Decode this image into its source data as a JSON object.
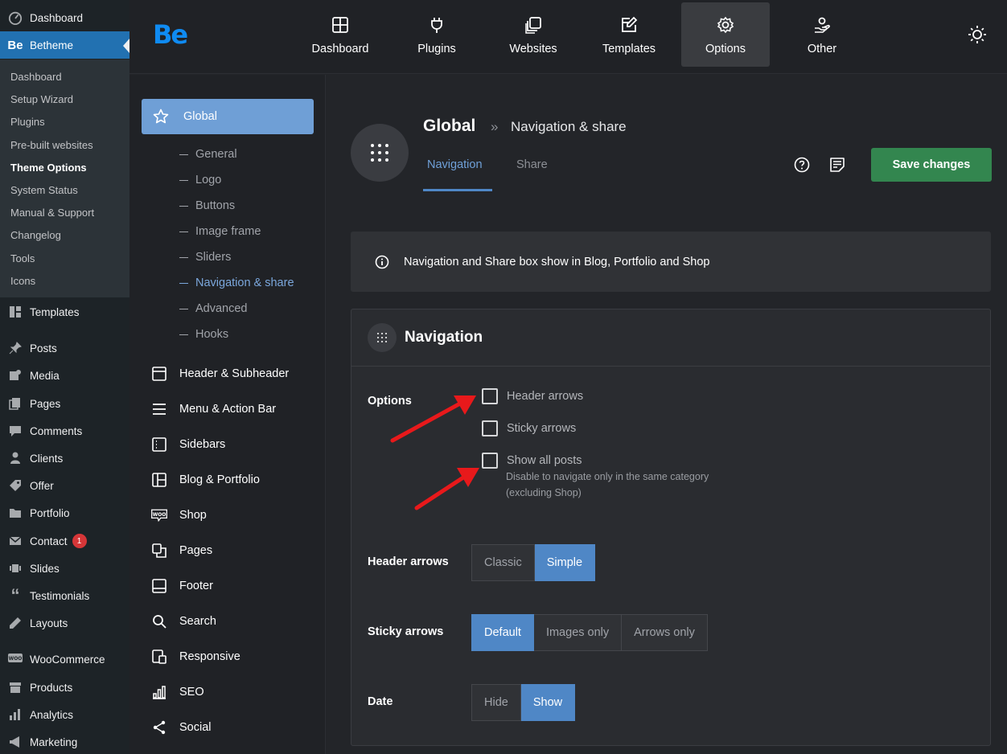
{
  "wp_menu": {
    "top": [
      {
        "label": "Dashboard",
        "icon": "dashboard-icon"
      },
      {
        "label": "Betheme",
        "icon": "betheme-logo-icon",
        "active": true
      }
    ],
    "submenu": [
      "Dashboard",
      "Setup Wizard",
      "Plugins",
      "Pre-built websites",
      "Theme Options",
      "System Status",
      "Manual & Support",
      "Changelog",
      "Tools",
      "Icons"
    ],
    "submenu_current": "Theme Options",
    "items": [
      {
        "label": "Templates",
        "icon": "templates-icon"
      },
      {
        "label": "Posts",
        "icon": "pin-icon"
      },
      {
        "label": "Media",
        "icon": "media-icon"
      },
      {
        "label": "Pages",
        "icon": "pages-icon"
      },
      {
        "label": "Comments",
        "icon": "comment-icon"
      },
      {
        "label": "Clients",
        "icon": "person-icon"
      },
      {
        "label": "Offer",
        "icon": "offer-icon"
      },
      {
        "label": "Portfolio",
        "icon": "folder-icon"
      },
      {
        "label": "Contact",
        "icon": "mail-icon",
        "badge": "1"
      },
      {
        "label": "Slides",
        "icon": "slides-icon"
      },
      {
        "label": "Testimonials",
        "icon": "quote-icon"
      },
      {
        "label": "Layouts",
        "icon": "pen-icon"
      },
      {
        "label": "WooCommerce",
        "icon": "woo-icon"
      },
      {
        "label": "Products",
        "icon": "archive-icon"
      },
      {
        "label": "Analytics",
        "icon": "bars-icon"
      },
      {
        "label": "Marketing",
        "icon": "megaphone-icon"
      }
    ]
  },
  "topbar": {
    "logo": "Be",
    "tabs": [
      {
        "label": "Dashboard",
        "icon": "dashboard-grid-icon"
      },
      {
        "label": "Plugins",
        "icon": "plug-icon"
      },
      {
        "label": "Websites",
        "icon": "websites-icon"
      },
      {
        "label": "Templates",
        "icon": "template-edit-icon"
      },
      {
        "label": "Options",
        "icon": "gear-icon",
        "active": true
      },
      {
        "label": "Other",
        "icon": "hand-person-icon"
      }
    ]
  },
  "options_nav": {
    "global": "Global",
    "global_children": [
      "General",
      "Logo",
      "Buttons",
      "Image frame",
      "Sliders",
      "Navigation & share",
      "Advanced",
      "Hooks"
    ],
    "global_active_child": "Navigation & share",
    "sections": [
      {
        "label": "Header & Subheader",
        "icon": "header-icon"
      },
      {
        "label": "Menu & Action Bar",
        "icon": "menu-icon"
      },
      {
        "label": "Sidebars",
        "icon": "sidebar-icon"
      },
      {
        "label": "Blog & Portfolio",
        "icon": "layout-icon"
      },
      {
        "label": "Shop",
        "icon": "woo-icon"
      },
      {
        "label": "Pages",
        "icon": "pages-copy-icon"
      },
      {
        "label": "Footer",
        "icon": "footer-icon"
      },
      {
        "label": "Search",
        "icon": "search-icon"
      },
      {
        "label": "Responsive",
        "icon": "responsive-icon"
      },
      {
        "label": "SEO",
        "icon": "seo-icon"
      },
      {
        "label": "Social",
        "icon": "share-icon"
      }
    ]
  },
  "main": {
    "breadcrumb_root": "Global",
    "breadcrumb_sep": "»",
    "breadcrumb_current": "Navigation & share",
    "tabs": [
      "Navigation",
      "Share"
    ],
    "active_tab": "Navigation",
    "save_label": "Save changes",
    "info_text": "Navigation and Share box show in Blog, Portfolio and Shop",
    "section_title": "Navigation",
    "options_label": "Options",
    "checkboxes": [
      {
        "label": "Header arrows",
        "checked": false
      },
      {
        "label": "Sticky arrows",
        "checked": false
      },
      {
        "label": "Show all posts",
        "checked": false,
        "desc_line1": "Disable to navigate only in the same category",
        "desc_line2": "(excluding Shop)"
      }
    ],
    "header_arrows": {
      "label": "Header arrows",
      "options": [
        "Classic",
        "Simple"
      ],
      "selected": "Simple"
    },
    "sticky_arrows": {
      "label": "Sticky arrows",
      "options": [
        "Default",
        "Images only",
        "Arrows only"
      ],
      "selected": "Default"
    },
    "date": {
      "label": "Date",
      "options": [
        "Hide",
        "Show"
      ],
      "selected": "Show"
    }
  },
  "colors": {
    "accent": "#4f87c6",
    "save": "#33864f",
    "logo": "#0f8bf2",
    "annotation_arrow": "#e8191b"
  }
}
